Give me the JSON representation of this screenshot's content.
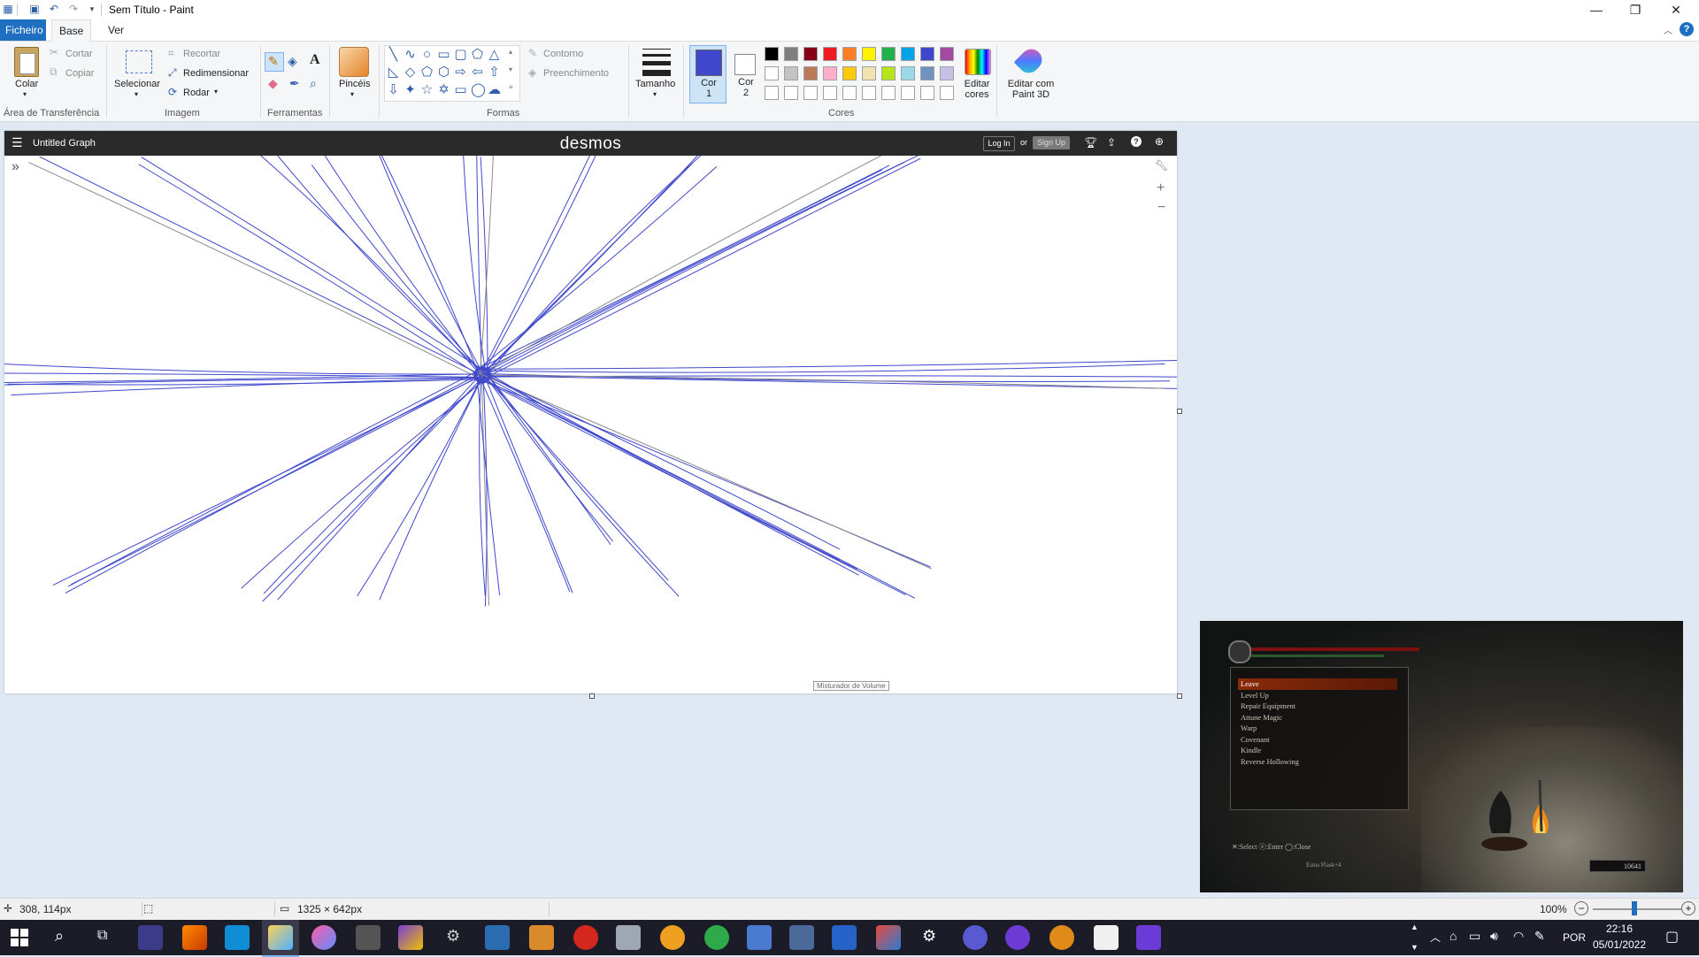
{
  "window": {
    "title": "Sem Título - Paint"
  },
  "ribbon": {
    "tabs": [
      "Ficheiro",
      "Base",
      "Ver"
    ],
    "clipboard": {
      "paste": "Colar",
      "cut": "Cortar",
      "copy": "Copiar",
      "group": "Área de Transferência"
    },
    "image": {
      "select": "Selecionar",
      "crop": "Recortar",
      "resize": "Redimensionar",
      "rotate": "Rodar",
      "group": "Imagem"
    },
    "tools": {
      "group": "Ferramentas"
    },
    "brushes": {
      "label": "Pincéis"
    },
    "shapes": {
      "outline": "Contorno",
      "fill": "Preenchimento",
      "group": "Formas"
    },
    "size": {
      "label": "Tamanho"
    },
    "colors": {
      "color1": "Cor 1",
      "color2": "Cor 2",
      "group": "Cores",
      "edit": "Editar cores",
      "paint3d": "Editar com Paint 3D",
      "color1_value": "#3f48cc",
      "color2_value": "#ffffff",
      "palette_row1": [
        "#000000",
        "#7f7f7f",
        "#880015",
        "#ed1c24",
        "#ff7f27",
        "#fff200",
        "#22b14c",
        "#00a2e8",
        "#3f48cc",
        "#a349a4"
      ],
      "palette_row2": [
        "#ffffff",
        "#c3c3c3",
        "#b97a57",
        "#ffaec9",
        "#ffc90e",
        "#efe4b0",
        "#b5e61d",
        "#99d9ea",
        "#7092be",
        "#c8bfe7"
      ]
    }
  },
  "desmos": {
    "menu_icon": "hamburger-icon",
    "graph_title": "Untitled Graph",
    "logo": "desmos",
    "login": "Log In",
    "or": "or",
    "signup": "Sign Up",
    "tooltip": "Misturador de Volume"
  },
  "game": {
    "menu_items": [
      "Leave",
      "Level Up",
      "Repair Equipment",
      "Attune Magic",
      "Warp",
      "Covenant",
      "Kindle",
      "Reverse Hollowing"
    ],
    "selected_index": 0,
    "controls": "✕:Select  ⓧ:Enter  ◯:Close",
    "item_label": "Estus Flask+4",
    "souls": "10641"
  },
  "status": {
    "cursor_pos": "308, 114px",
    "canvas_size": "1325 × 642px",
    "zoom": "100%"
  },
  "taskbar": {
    "language": "POR",
    "time": "22:16",
    "date": "05/01/2022"
  }
}
